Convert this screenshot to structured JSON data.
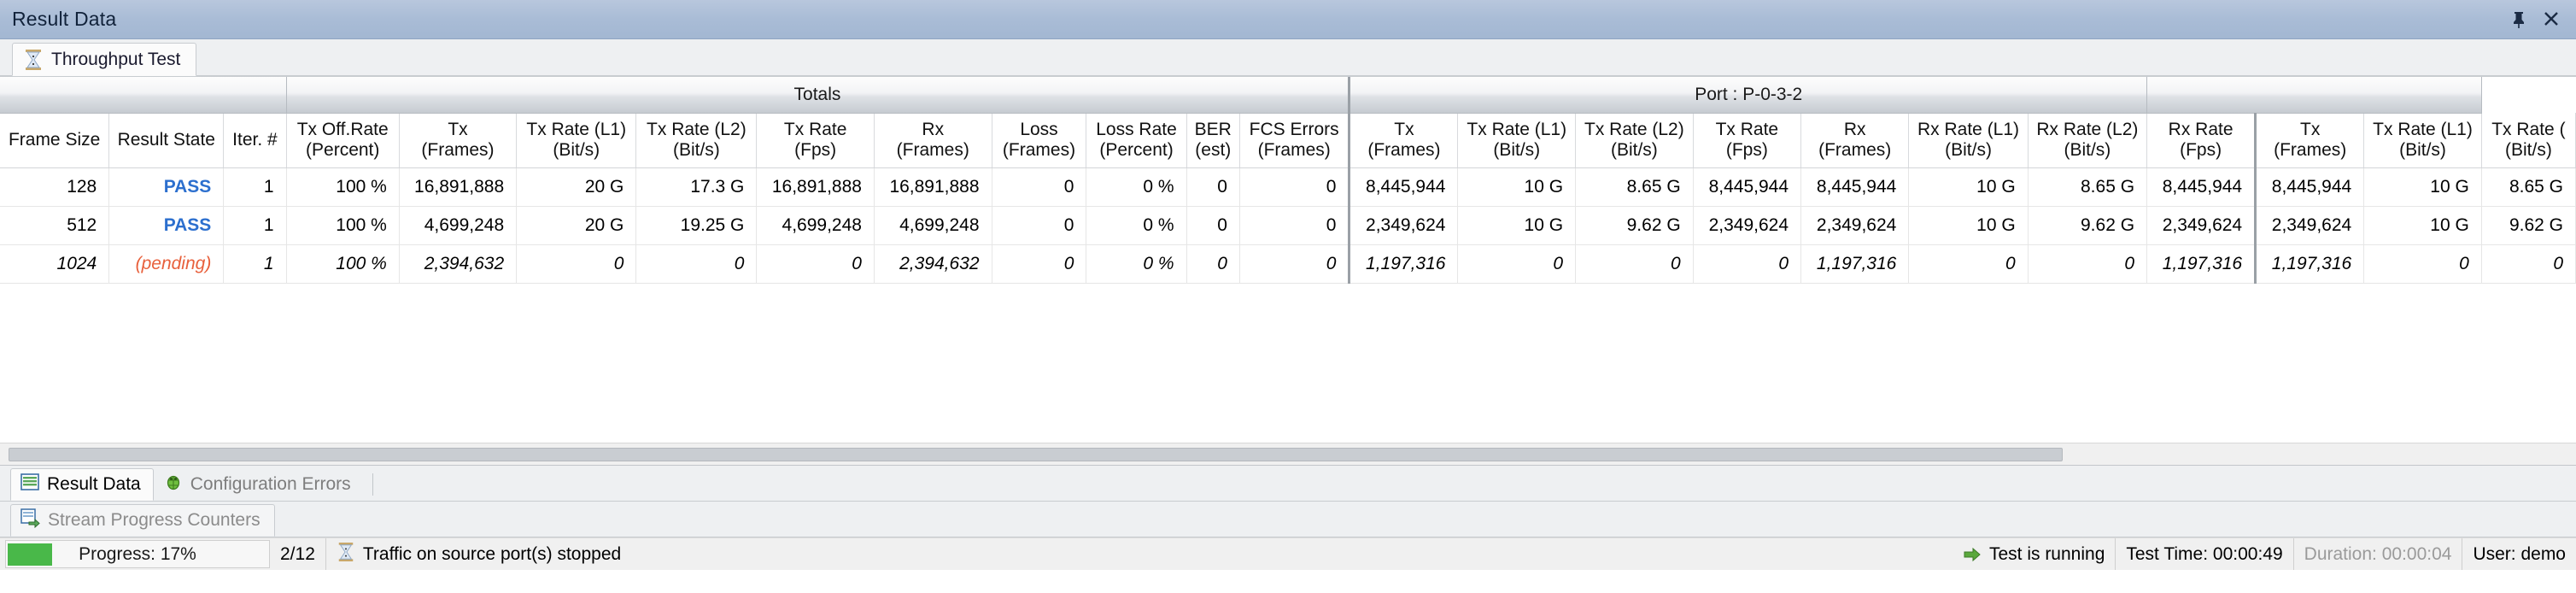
{
  "window": {
    "title": "Result Data",
    "pin_icon": "pin-icon",
    "close_icon": "close-icon"
  },
  "top_tabs": [
    {
      "label": "Throughput Test",
      "icon": "hourglass-icon",
      "active": true
    }
  ],
  "grid": {
    "groups": [
      {
        "label": "",
        "span": 3,
        "blank": true
      },
      {
        "label": "Totals",
        "span": 10
      },
      {
        "label": "Port : P-0-3-2",
        "span": 7
      },
      {
        "label": "",
        "span": 3,
        "blank": true
      }
    ],
    "columns": [
      {
        "line1": "Frame Size",
        "line2": "",
        "width": 150
      },
      {
        "line1": "Result State",
        "line2": "",
        "width": 153
      },
      {
        "line1": "Iter. #",
        "line2": "",
        "width": 95
      },
      {
        "line1": "Tx Off.Rate",
        "line2": "(Percent)",
        "width": 167
      },
      {
        "line1": "Tx",
        "line2": "(Frames)",
        "width": 169
      },
      {
        "line1": "Tx Rate (L1)",
        "line2": "(Bit/s)",
        "width": 170
      },
      {
        "line1": "Tx Rate (L2)",
        "line2": "(Bit/s)",
        "width": 173
      },
      {
        "line1": "Tx Rate",
        "line2": "(Fps)",
        "width": 170
      },
      {
        "line1": "Rx",
        "line2": "(Frames)",
        "width": 170
      },
      {
        "line1": "Loss",
        "line2": "(Frames)",
        "width": 147
      },
      {
        "line1": "Loss Rate",
        "line2": "(Percent)",
        "width": 144
      },
      {
        "line1": "BER",
        "line2": "(est)",
        "width": 80
      },
      {
        "line1": "FCS Errors",
        "line2": "(Frames)",
        "width": 155
      },
      {
        "line1": "Tx",
        "line2": "(Frames)",
        "width": 160,
        "group_start": true
      },
      {
        "line1": "Tx Rate (L1)",
        "line2": "(Bit/s)",
        "width": 160
      },
      {
        "line1": "Tx Rate (L2)",
        "line2": "(Bit/s)",
        "width": 160
      },
      {
        "line1": "Tx Rate",
        "line2": "(Fps)",
        "width": 160
      },
      {
        "line1": "Rx",
        "line2": "(Frames)",
        "width": 160
      },
      {
        "line1": "Rx Rate (L1)",
        "line2": "(Bit/s)",
        "width": 160
      },
      {
        "line1": "Rx Rate (L2)",
        "line2": "(Bit/s)",
        "width": 160
      },
      {
        "line1": "Rx Rate",
        "line2": "(Fps)",
        "width": 160
      },
      {
        "line1": "Tx",
        "line2": "(Frames)",
        "width": 160,
        "group_start": true
      },
      {
        "line1": "Tx Rate (L1)",
        "line2": "(Bit/s)",
        "width": 160
      },
      {
        "line1": "Tx Rate (",
        "line2": "(Bit/s)",
        "width": 140
      }
    ],
    "rows": [
      {
        "state": "PASS",
        "pending": false,
        "cells": [
          "128",
          "PASS",
          "1",
          "100 %",
          "16,891,888",
          "20 G",
          "17.3 G",
          "16,891,888",
          "16,891,888",
          "0",
          "0 %",
          "0",
          "0",
          "8,445,944",
          "10 G",
          "8.65 G",
          "8,445,944",
          "8,445,944",
          "10 G",
          "8.65 G",
          "8,445,944",
          "8,445,944",
          "10 G",
          "8.65 G"
        ]
      },
      {
        "state": "PASS",
        "pending": false,
        "cells": [
          "512",
          "PASS",
          "1",
          "100 %",
          "4,699,248",
          "20 G",
          "19.25 G",
          "4,699,248",
          "4,699,248",
          "0",
          "0 %",
          "0",
          "0",
          "2,349,624",
          "10 G",
          "9.62 G",
          "2,349,624",
          "2,349,624",
          "10 G",
          "9.62 G",
          "2,349,624",
          "2,349,624",
          "10 G",
          "9.62 G"
        ]
      },
      {
        "state": "(pending)",
        "pending": true,
        "cells": [
          "1024",
          "(pending)",
          "1",
          "100 %",
          "2,394,632",
          "0",
          "0",
          "0",
          "2,394,632",
          "0",
          "0 %",
          "0",
          "0",
          "1,197,316",
          "0",
          "0",
          "0",
          "1,197,316",
          "0",
          "0",
          "1,197,316",
          "1,197,316",
          "0",
          "0"
        ]
      }
    ]
  },
  "bottom_tabs": [
    {
      "label": "Result Data",
      "icon": "grid-icon",
      "active": true
    },
    {
      "label": "Configuration Errors",
      "icon": "bug-icon",
      "active": false
    }
  ],
  "bottom_tabs2": [
    {
      "label": "Stream Progress Counters",
      "icon": "stream-counters-icon",
      "active": false
    }
  ],
  "statusbar": {
    "progress_label": "Progress: 17%",
    "progress_percent": 17,
    "progress_color": "#49b849",
    "counter": "2/12",
    "activity_icon": "hourglass-icon",
    "activity_text": "Traffic on source port(s) stopped",
    "run_icon": "green-arrow-icon",
    "run_text": "Test is running",
    "test_time": "Test Time: 00:00:49",
    "duration": "Duration: 00:00:04",
    "user": "User: demo"
  }
}
